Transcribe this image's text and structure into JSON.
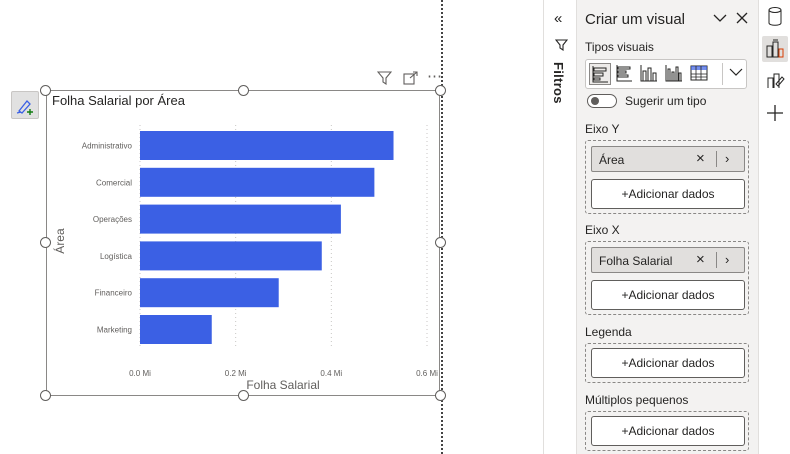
{
  "visual": {
    "title": "Folha Salarial por Área",
    "header_icons": [
      "filter-icon",
      "focus-mode-icon",
      "more-options-icon"
    ]
  },
  "chart_data": {
    "type": "bar",
    "orientation": "horizontal",
    "categories": [
      "Administrativo",
      "Comercial",
      "Operações",
      "Logística",
      "Financeiro",
      "Marketing"
    ],
    "values": [
      0.53,
      0.49,
      0.42,
      0.38,
      0.29,
      0.15
    ],
    "bar_color": "#3b60e4",
    "xlabel": "Folha Salarial",
    "ylabel": "Área",
    "xticks": [
      "0.0 Mi",
      "0.2 Mi",
      "0.4 Mi",
      "0.6 Mi"
    ],
    "xlim": [
      0,
      0.6
    ],
    "grid": true
  },
  "filters": {
    "label": "Filtros"
  },
  "pane": {
    "title": "Criar um visual",
    "visual_types_label": "Tipos visuais",
    "visual_types": [
      "stacked-bar-chart-icon",
      "clustered-bar-chart-icon",
      "stacked-column-chart-icon",
      "clustered-column-chart-icon",
      "table-icon"
    ],
    "suggest_label": "Sugerir um tipo",
    "wells": {
      "y_axis": {
        "label": "Eixo Y",
        "field": "Área",
        "add_label": "+Adicionar dados"
      },
      "x_axis": {
        "label": "Eixo X",
        "field": "Folha Salarial",
        "add_label": "+Adicionar dados"
      },
      "legend": {
        "label": "Legenda",
        "add_label": "+Adicionar dados"
      },
      "small_multiples": {
        "label": "Múltiplos pequenos",
        "add_label": "+Adicionar dados"
      }
    }
  },
  "rail": [
    "data-icon",
    "build-visual-icon",
    "format-visual-icon",
    "add-icon"
  ]
}
